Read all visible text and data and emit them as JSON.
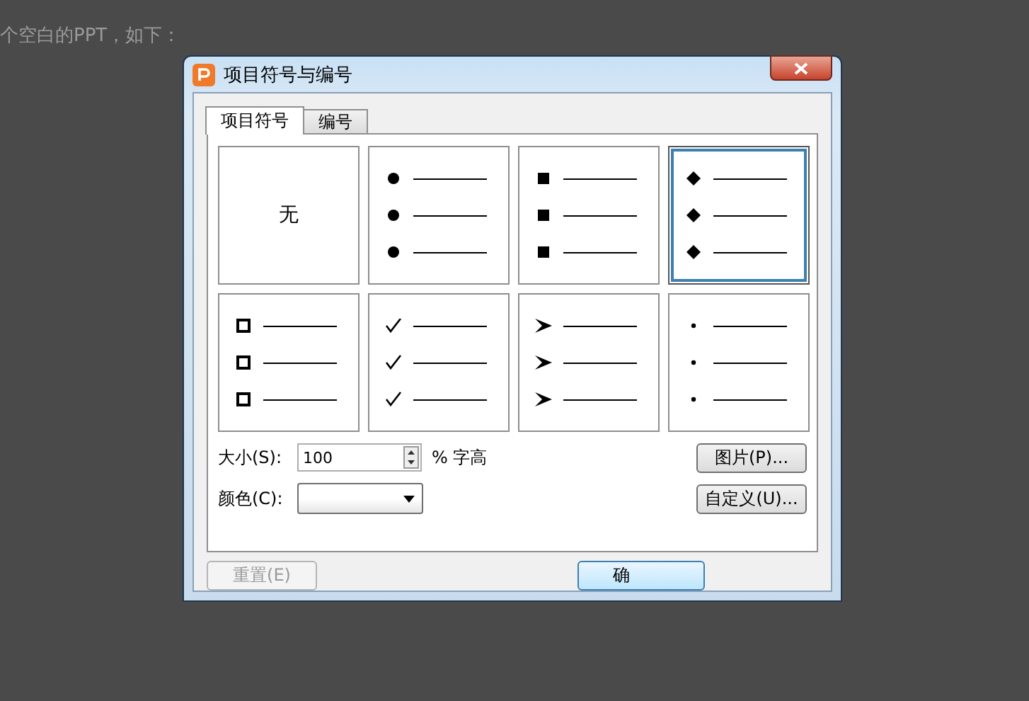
{
  "background_text": "个空白的PPT，如下：",
  "window": {
    "title": "项目符号与编号"
  },
  "tabs": [
    {
      "label": "项目符号",
      "selected": true
    },
    {
      "label": "编号",
      "selected": false
    }
  ],
  "bullet_styles": [
    {
      "kind": "none",
      "label": "无",
      "selected": false
    },
    {
      "kind": "dot",
      "selected": false
    },
    {
      "kind": "square",
      "selected": false
    },
    {
      "kind": "diamond",
      "selected": true
    },
    {
      "kind": "hollow-square",
      "selected": false
    },
    {
      "kind": "check",
      "selected": false
    },
    {
      "kind": "arrow",
      "selected": false
    },
    {
      "kind": "small-dot",
      "selected": false
    }
  ],
  "size": {
    "label": "大小(S):",
    "value": "100",
    "unit": "% 字高"
  },
  "color": {
    "label": "颜色(C):"
  },
  "side_buttons": [
    "图片(P)...",
    "自定义(U)..."
  ],
  "reset_button": {
    "label": "重置(E)",
    "disabled": true
  },
  "ok_button": {
    "label": "确"
  }
}
